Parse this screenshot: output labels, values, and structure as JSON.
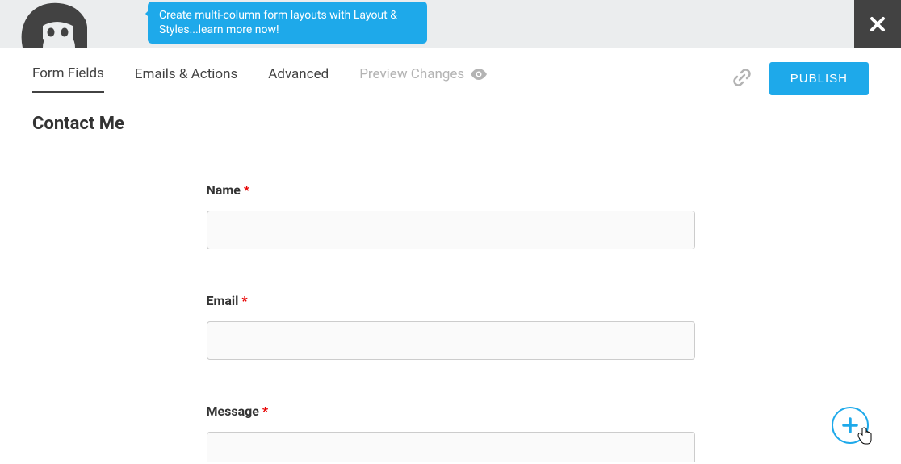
{
  "tooltip": {
    "text": "Create multi-column form layouts with Layout & Styles...learn more now!"
  },
  "nav": {
    "tabs": [
      {
        "label": "Form Fields"
      },
      {
        "label": "Emails & Actions"
      },
      {
        "label": "Advanced"
      },
      {
        "label": "Preview Changes"
      }
    ]
  },
  "actions": {
    "publish_label": "PUBLISH"
  },
  "form": {
    "title": "Contact Me",
    "fields": [
      {
        "label": "Name",
        "required": true
      },
      {
        "label": "Email",
        "required": true
      },
      {
        "label": "Message",
        "required": true
      }
    ],
    "required_mark": "*"
  }
}
